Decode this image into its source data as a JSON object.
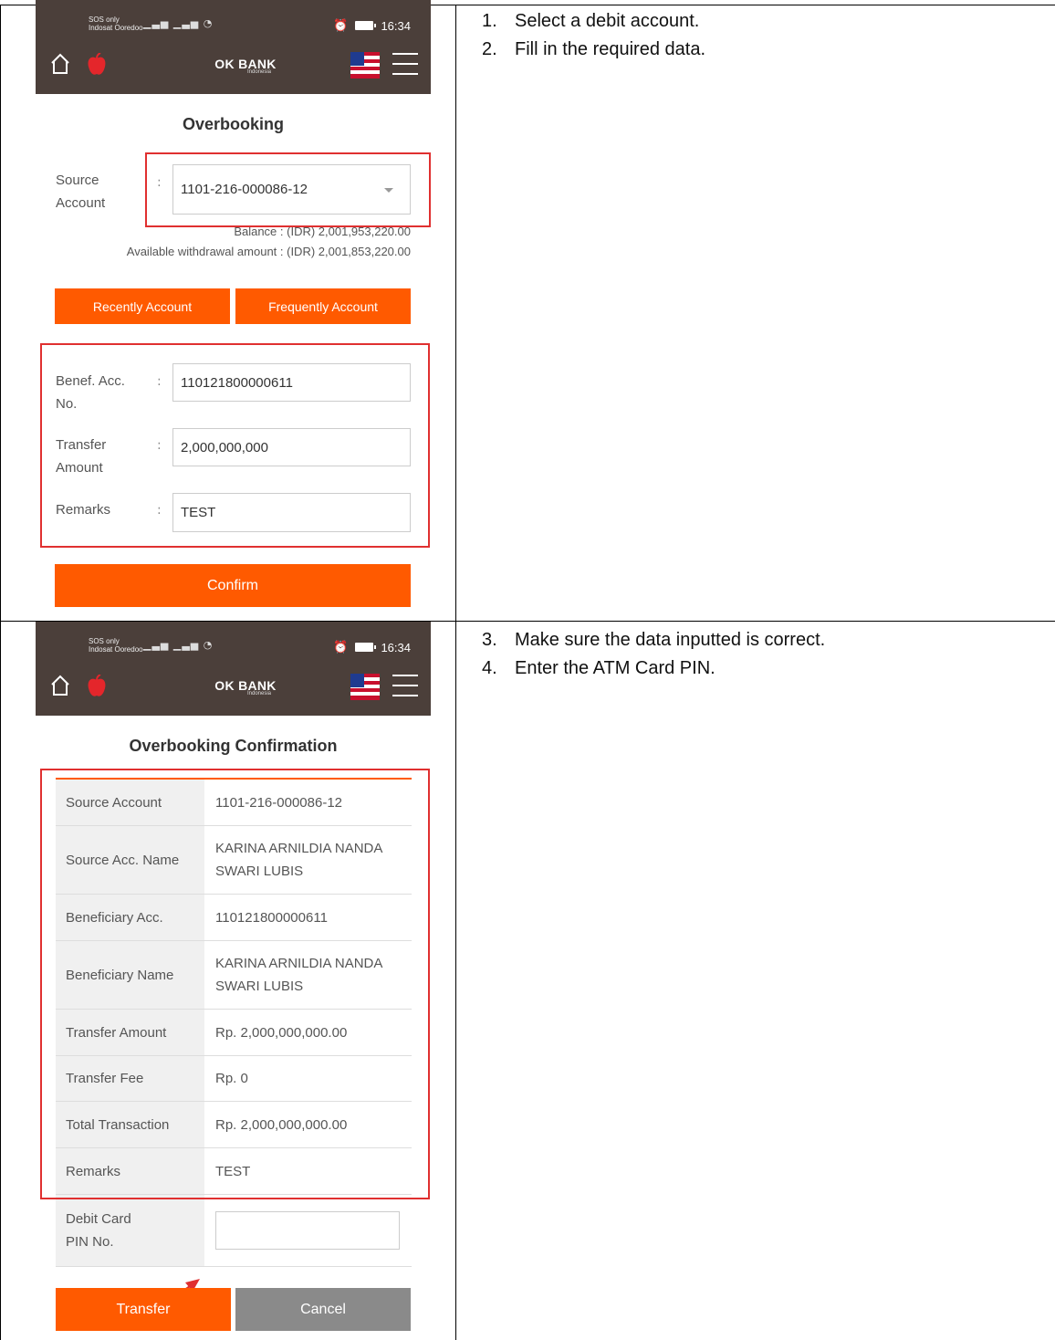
{
  "status_bar": {
    "sim_line1": "SOS only",
    "sim_line2": "Indosat Ooredoo",
    "time": "16:34"
  },
  "brand": {
    "name": "OK BANK",
    "sub": "Indonesia"
  },
  "step1": {
    "title": "Overbooking",
    "source_account_label_1": "Source",
    "source_account_label_2": "Account",
    "source_account_value": "1101-216-000086-12",
    "balance": "Balance : (IDR) 2,001,953,220.00",
    "available": "Available withdrawal amount : (IDR) 2,001,853,220.00",
    "recent_button": "Recently Account",
    "frequent_button": "Frequently Account",
    "benef_label_1": "Benef. Acc.",
    "benef_label_2": "No.",
    "benef_value": "110121800000611",
    "amount_label_1": "Transfer",
    "amount_label_2": "Amount",
    "amount_value": "2,000,000,000",
    "remarks_label": "Remarks",
    "remarks_value": "TEST",
    "confirm_button": "Confirm"
  },
  "step2": {
    "title": "Overbooking Confirmation",
    "rows": [
      {
        "k": "Source Account",
        "v1": "1101-216-000086-12",
        "v2": ""
      },
      {
        "k": "Source Acc. Name",
        "v1": "KARINA ARNILDIA NANDA",
        "v2": "SWARI LUBIS"
      },
      {
        "k": "Beneficiary Acc.",
        "v1": "110121800000611",
        "v2": ""
      },
      {
        "k": "Beneficiary Name",
        "v1": "KARINA ARNILDIA NANDA",
        "v2": "SWARI LUBIS"
      },
      {
        "k": "Transfer Amount",
        "v1": "Rp. 2,000,000,000.00",
        "v2": ""
      },
      {
        "k": "Transfer Fee",
        "v1": "Rp. 0",
        "v2": ""
      },
      {
        "k": "Total Transaction",
        "v1": "Rp. 2,000,000,000.00",
        "v2": ""
      },
      {
        "k": "Remarks",
        "v1": "TEST",
        "v2": ""
      }
    ],
    "pin_label_1": "Debit Card",
    "pin_label_2": "PIN No.",
    "transfer_button": "Transfer",
    "cancel_button": "Cancel"
  },
  "instructions": [
    {
      "num": "1.",
      "text": "Select a debit account."
    },
    {
      "num": "2.",
      "text": "Fill in the required data."
    },
    {
      "num": "3.",
      "text": "Make sure the data inputted is correct."
    },
    {
      "num": "4.",
      "text": "Enter the ATM Card PIN."
    }
  ],
  "colors": {
    "accent": "#ff5a00",
    "header": "#4b3f3a",
    "highlight": "#e03030"
  }
}
